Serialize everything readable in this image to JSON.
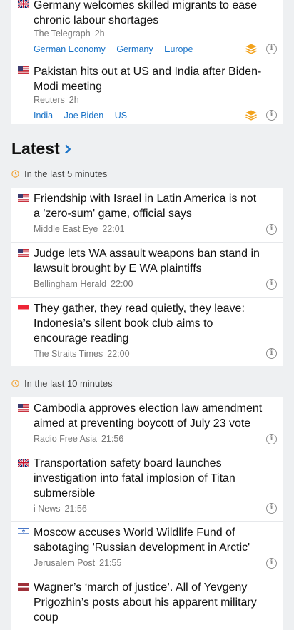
{
  "colors": {
    "accent": "#1a73c8",
    "clock": "#f0a43a",
    "stack": "#f2a21c"
  },
  "top_card": [
    {
      "flag": "uk-flag-icon",
      "title": "Germany welcomes skilled migrants to ease chronic labour shortages",
      "source": "The Telegraph",
      "time": "2h",
      "tags": [
        "German Economy",
        "Germany",
        "Europe"
      ]
    },
    {
      "flag": "us-flag-icon",
      "title": "Pakistan hits out at US and India after Biden-Modi meeting",
      "source": "Reuters",
      "time": "2h",
      "tags": [
        "India",
        "Joe Biden",
        "US"
      ]
    }
  ],
  "latest": {
    "heading": "Latest",
    "groups": [
      {
        "label": "In the last 5 minutes",
        "items": [
          {
            "flag": "us-flag-icon",
            "title": "Friendship with Israel in Latin America is not a 'zero-sum' game, official says",
            "source": "Middle East Eye",
            "time": "22:01"
          },
          {
            "flag": "us-flag-icon",
            "title": "Judge lets WA assault weapons ban stand in lawsuit brought by E WA plaintiffs",
            "source": "Bellingham Herald",
            "time": "22:00"
          },
          {
            "flag": "singapore-flag-icon",
            "title": "They gather, they read quietly, they leave: Indonesia’s silent book club aims to encourage reading",
            "source": "The Straits Times",
            "time": "22:00"
          }
        ]
      },
      {
        "label": "In the last 10 minutes",
        "items": [
          {
            "flag": "us-flag-icon",
            "title": "Cambodia approves election law amendment aimed at preventing boycott of July 23 vote",
            "source": "Radio Free Asia",
            "time": "21:56"
          },
          {
            "flag": "uk-flag-icon",
            "title": "Transportation safety board launches investigation into fatal implosion of Titan submersible",
            "source": "i News",
            "time": "21:56"
          },
          {
            "flag": "israel-flag-icon",
            "title": "Moscow accuses World Wildlife Fund of sabotaging 'Russian development in Arctic'",
            "source": "Jerusalem Post",
            "time": "21:55"
          },
          {
            "flag": "latvia-flag-icon",
            "title": "Wagner’s ‘march of justice’. All of Yevgeny Prigozhin’s posts about his apparent military coup",
            "source": "",
            "time": ""
          }
        ]
      }
    ]
  }
}
